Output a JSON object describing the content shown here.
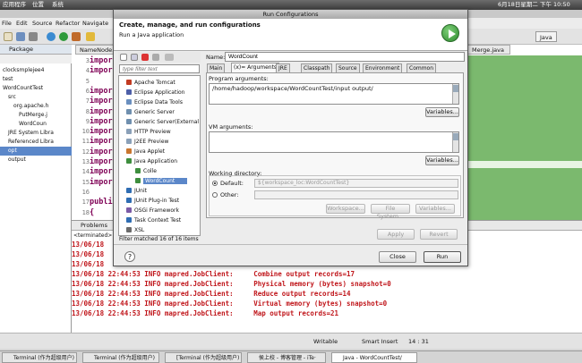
{
  "topbar": {
    "apps": "应用程序",
    "places": "位置",
    "system": "系统",
    "datetime": "6月18日星期二 下午 10:50"
  },
  "eclipse": {
    "menus": [
      "File",
      "Edit",
      "Source",
      "Refactor",
      "Navigate"
    ],
    "perspective": "Java",
    "package_tab": "Package",
    "tree": [
      {
        "label": "clocksmplejee4",
        "indent": 0
      },
      {
        "label": "test",
        "indent": 0
      },
      {
        "label": "WordCountTest",
        "indent": 0
      },
      {
        "label": "src",
        "indent": 1
      },
      {
        "label": "org.apache.h",
        "indent": 2
      },
      {
        "label": "PutMerge.j",
        "indent": 3
      },
      {
        "label": "WordCoun",
        "indent": 3
      },
      {
        "label": "JRE System Libra",
        "indent": 1
      },
      {
        "label": "Referenced Libra",
        "indent": 1
      },
      {
        "label": "opt",
        "indent": 1,
        "selected": true
      },
      {
        "label": "output",
        "indent": 1
      }
    ],
    "editor_tab": "NameNode.j",
    "editor_tab_right": "Merge.java",
    "code_lines": [
      {
        "ln": "3",
        "text": "impor"
      },
      {
        "ln": "4",
        "text": "impor"
      },
      {
        "ln": "5",
        "text": ""
      },
      {
        "ln": "6",
        "text": "impor"
      },
      {
        "ln": "7",
        "text": "impor"
      },
      {
        "ln": "8",
        "text": "impor"
      },
      {
        "ln": "9",
        "text": "impor"
      },
      {
        "ln": "10",
        "text": "impor"
      },
      {
        "ln": "11",
        "text": "impor"
      },
      {
        "ln": "12",
        "text": "impor"
      },
      {
        "ln": "13",
        "text": "impor"
      },
      {
        "ln": "14",
        "text": "impor"
      },
      {
        "ln": "15",
        "text": "impor"
      },
      {
        "ln": "16",
        "text": ""
      },
      {
        "ln": "17",
        "text": "publi"
      },
      {
        "ln": "18",
        "text": "{"
      }
    ],
    "console_tab": "Problems",
    "console_terminated": "<terminated>",
    "console_lines": [
      "13/06/18",
      "13/06/18",
      "13/06/18",
      "13/06/18 22:44:53 INFO mapred.JobClient:     Combine output records=17",
      "13/06/18 22:44:53 INFO mapred.JobClient:     Physical memory (bytes) snapshot=0",
      "13/06/18 22:44:53 INFO mapred.JobClient:     Reduce output records=14",
      "13/06/18 22:44:53 INFO mapred.JobClient:     Virtual memory (bytes) snapshot=0",
      "13/06/18 22:44:53 INFO mapred.JobClient:     Map output records=21"
    ],
    "status": {
      "writable": "Writable",
      "insert": "Smart Insert",
      "position": "14 : 31"
    }
  },
  "dialog": {
    "title": "Run Configurations",
    "heading": "Create, manage, and run configurations",
    "subheading": "Run a Java application",
    "filter_placeholder": "type filter text",
    "config_items": [
      {
        "label": "Apache Tomcat",
        "color": "#c23b22",
        "indent": 0
      },
      {
        "label": "Eclipse Application",
        "color": "#4d5fa8",
        "indent": 0
      },
      {
        "label": "Eclipse Data Tools",
        "color": "#6a8fbf",
        "indent": 0
      },
      {
        "label": "Generic Server",
        "color": "#6f8fae",
        "indent": 0
      },
      {
        "label": "Generic Server(External",
        "color": "#6f8fae",
        "indent": 0
      },
      {
        "label": "HTTP Preview",
        "color": "#8aa0b8",
        "indent": 0
      },
      {
        "label": "J2EE Preview",
        "color": "#8aa0b8",
        "indent": 0
      },
      {
        "label": "Java Applet",
        "color": "#c9762f",
        "indent": 0
      },
      {
        "label": "Java Application",
        "color": "#3e8e3e",
        "indent": 0
      },
      {
        "label": "Colle",
        "color": "#3e8e3e",
        "indent": 1
      },
      {
        "label": "WordCount",
        "color": "#3e8e3e",
        "indent": 1,
        "selected": true
      },
      {
        "label": "JUnit",
        "color": "#2f6db3",
        "indent": 0
      },
      {
        "label": "JUnit Plug-in Test",
        "color": "#2f6db3",
        "indent": 0
      },
      {
        "label": "OSGi Framework",
        "color": "#7b5aa6",
        "indent": 0
      },
      {
        "label": "Task Context Test",
        "color": "#2f6db3",
        "indent": 0
      },
      {
        "label": "XSL",
        "color": "#6a6a6a",
        "indent": 0
      }
    ],
    "filter_status": "Filter matched 16 of 16 items",
    "name_label": "Name:",
    "name_value": "WordCount",
    "tabs": [
      "Main",
      "(x)= Arguments",
      "JRE",
      "Classpath",
      "Source",
      "Environment",
      "Common"
    ],
    "program_args_label": "Program arguments:",
    "program_args_value": "/home/hadoop/workspace/WordCountTest/input output/",
    "variables_label": "Variables...",
    "vm_args_label": "VM arguments:",
    "workdir_label": "Working directory:",
    "default_label": "Default:",
    "default_value": "${workspace_loc:WordCountTest}",
    "other_label": "Other:",
    "workspace_btn": "Workspace...",
    "filesystem_btn": "File System...",
    "variables_btn": "Variables...",
    "apply_btn": "Apply",
    "revert_btn": "Revert",
    "close_btn": "Close",
    "run_btn": "Run",
    "help_glyph": "?"
  },
  "taskbar": [
    {
      "label": "Terminal (作为超级用户)",
      "active": false
    },
    {
      "label": "Terminal (作为超级用户)",
      "active": false
    },
    {
      "label": "[Terminal (作为超级用户)",
      "active": false
    },
    {
      "label": "侯上校 - 博客管理 - iTe·",
      "active": false
    },
    {
      "label": "Java - WordCountTest/",
      "active": true
    }
  ]
}
